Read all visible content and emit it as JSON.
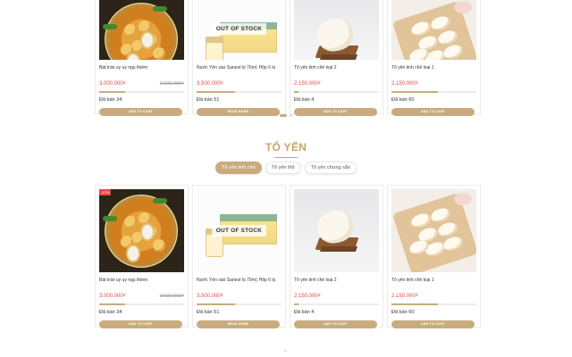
{
  "carousel_top": {
    "products": [
      {
        "name": "Bát tràn uy uy ngụ thiềm",
        "price": "3.000.000₫",
        "old_price": "3.600.000₫",
        "sold_label": "Đã bán 34",
        "button": "ADD TO CART",
        "progress": 0.3,
        "art": "soup",
        "out_of_stock": false,
        "badge": ""
      },
      {
        "name": "Nước Yến sào Sanest lọ 70ml, Hộp 6 lọ",
        "price": "3.500.000₫",
        "old_price": "",
        "sold_label": "Đã bán 51",
        "button": "READ MORE",
        "progress": 0.45,
        "art": "box",
        "out_of_stock": true,
        "oos_label": "OUT OF STOCK",
        "badge": ""
      },
      {
        "name": "Tổ yến tinh chế loại 2",
        "price": "2.150.000₫",
        "old_price": "",
        "sold_label": "Đã bán 4",
        "button": "ADD TO CART",
        "progress": 0.05,
        "art": "nest",
        "out_of_stock": false,
        "badge": ""
      },
      {
        "name": "Tổ yến tinh chế loại 1",
        "price": "2.150.000₫",
        "old_price": "",
        "sold_label": "Đã bán 60",
        "button": "ADD TO CART",
        "progress": 0.55,
        "art": "plate",
        "out_of_stock": false,
        "badge": ""
      }
    ]
  },
  "section": {
    "title": "TỔ YẾN",
    "tabs": [
      {
        "label": "Tổ yến tinh chế",
        "active": true
      },
      {
        "label": "Tổ yến thô",
        "active": false
      },
      {
        "label": "Tổ yến chưng sẵn",
        "active": false
      }
    ]
  },
  "grid_bottom": {
    "products": [
      {
        "name": "Bát tràn uy uy ngụ thiềm",
        "price": "3.000.000₫",
        "old_price": "3.600.000₫",
        "sold_label": "Đã bán 34",
        "button": "ADD TO CART",
        "progress": 0.3,
        "art": "soup",
        "out_of_stock": false,
        "badge": "-17%"
      },
      {
        "name": "Nước Yến sào Sanest lọ 70ml, Hộp 6 lọ",
        "price": "3.500.000₫",
        "old_price": "",
        "sold_label": "Đã bán 51",
        "button": "READ MORE",
        "progress": 0.45,
        "art": "box",
        "out_of_stock": true,
        "oos_label": "OUT OF STOCK",
        "badge": ""
      },
      {
        "name": "Tổ yến tinh chế loại 2",
        "price": "2.150.000₫",
        "old_price": "",
        "sold_label": "Đã bán 4",
        "button": "ADD TO CART",
        "progress": 0.05,
        "art": "nest",
        "out_of_stock": false,
        "badge": ""
      },
      {
        "name": "Tổ yến tinh chế loại 1",
        "price": "2.150.000₫",
        "old_price": "",
        "sold_label": "Đã bán 60",
        "button": "ADD TO CART",
        "progress": 0.55,
        "art": "plate",
        "out_of_stock": false,
        "badge": ""
      }
    ]
  },
  "colors": {
    "accent": "#c9ab7f",
    "title": "#c9a46b",
    "price": "#e24a4a"
  }
}
